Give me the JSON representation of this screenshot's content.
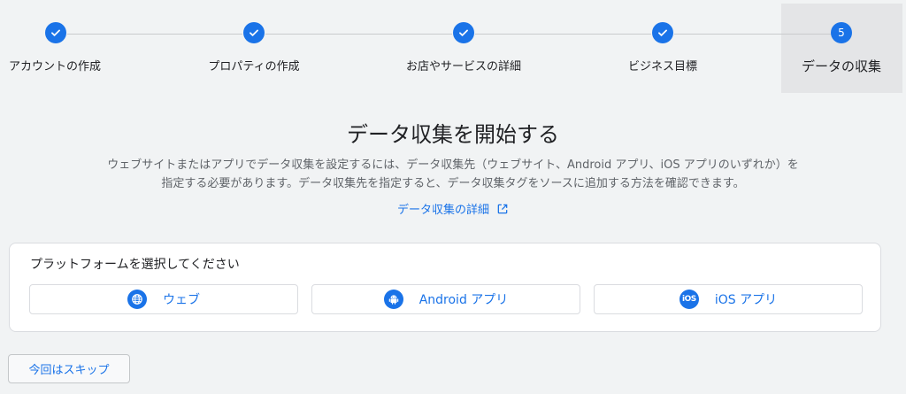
{
  "stepper": {
    "steps": [
      {
        "label": "アカウントの作成",
        "status": "done"
      },
      {
        "label": "プロパティの作成",
        "status": "done"
      },
      {
        "label": "お店やサービスの詳細",
        "status": "done"
      },
      {
        "label": "ビジネス目標",
        "status": "done"
      },
      {
        "label": "データの収集",
        "status": "active",
        "number": "5"
      }
    ]
  },
  "main": {
    "title": "データ収集を開始する",
    "description": "ウェブサイトまたはアプリでデータ収集を設定するには、データ収集先（ウェブサイト、Android アプリ、iOS アプリのいずれか）を指定する必要があります。データ収集先を指定すると、データ収集タグをソースに追加する方法を確認できます。",
    "learn_more_link": "データ収集の詳細"
  },
  "platform_card": {
    "title": "プラットフォームを選択してください",
    "buttons": [
      {
        "label": "ウェブ",
        "icon": "globe-icon"
      },
      {
        "label": "Android アプリ",
        "icon": "android-icon"
      },
      {
        "label": "iOS アプリ",
        "icon": "ios-icon",
        "icon_text": "iOS"
      }
    ]
  },
  "skip_button": "今回はスキップ",
  "colors": {
    "accent": "#1a73e8",
    "background": "#f1f3f4",
    "active_step_bg": "#e4e5e7"
  }
}
